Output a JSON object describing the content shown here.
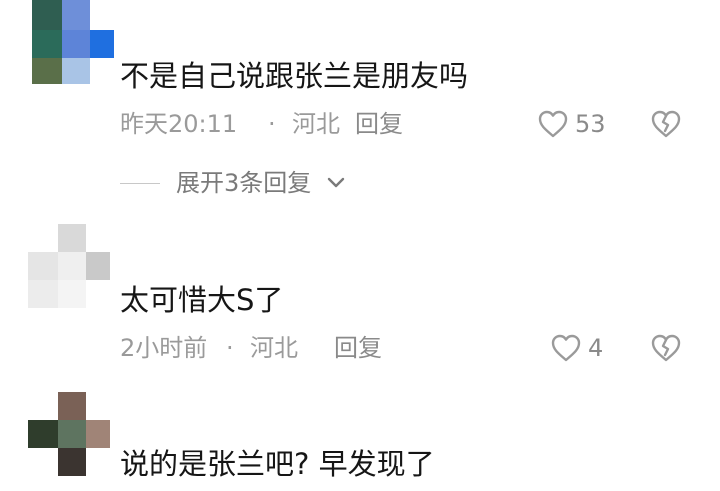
{
  "comments": [
    {
      "text": "不是自己说跟张兰是朋友吗",
      "time": "昨天20:11",
      "separator": "·",
      "location": "河北",
      "reply_label": "回复",
      "likes": "53",
      "avatar_colors": [
        "#3a7a6a",
        "#5580d8",
        "#1f6fe0",
        "#4d6b4a",
        "#a9c4e6",
        "#e9eef7"
      ]
    },
    {
      "text": "太可惜大S了",
      "time": "2小时前",
      "separator": "·",
      "location": "河北",
      "reply_label": "回复",
      "likes": "4",
      "avatar_colors": [
        "#ffffff",
        "#dcdcdc",
        "#f1f1f1",
        "#e2e2e2",
        "#ececec",
        "#c9c9c9",
        "#f5f5f5"
      ]
    },
    {
      "text": "说的是张兰吧? 早发现了",
      "avatar_colors": [
        "#e8e8e8",
        "#7a5f52",
        "#44503f",
        "#5d7260",
        "#9a8478",
        "#3c3632"
      ]
    }
  ],
  "expand_replies_label": "展开3条回复",
  "icons": {
    "like": "heart-outline-icon",
    "dislike": "broken-heart-icon",
    "expand": "chevron-down-icon"
  }
}
